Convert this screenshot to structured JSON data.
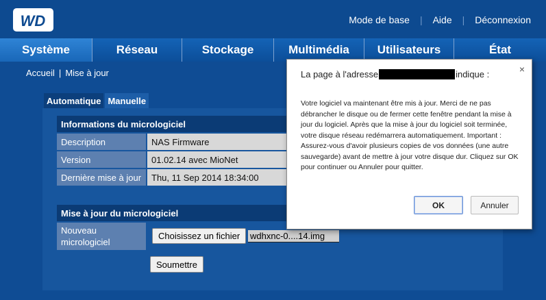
{
  "header": {
    "links": [
      "Mode de base",
      "Aide",
      "Déconnexion"
    ]
  },
  "nav": {
    "tabs": [
      "Système",
      "Réseau",
      "Stockage",
      "Multimédia",
      "Utilisateurs",
      "État"
    ],
    "active": "Système"
  },
  "breadcrumb": {
    "home": "Accueil",
    "separator": "|",
    "current": "Mise à jour"
  },
  "subtabs": {
    "auto": "Automatique",
    "manual": "Manuelle"
  },
  "firmware_info": {
    "title": "Informations du micrologiciel",
    "rows": [
      {
        "label": "Description",
        "value": "NAS Firmware"
      },
      {
        "label": "Version",
        "value": "01.02.14 avec MioNet"
      },
      {
        "label": "Dernière mise à jour",
        "value": "Thu, 11 Sep 2014 18:34:00"
      }
    ]
  },
  "firmware_update": {
    "title": "Mise à jour du micrologiciel",
    "new_label": "Nouveau micrologiciel",
    "choose_file": "Choisissez un fichier",
    "file_name": "wdhxnc-0....14.img",
    "submit": "Soumettre"
  },
  "dialog": {
    "title_prefix": "La page à l'adresse",
    "title_suffix": "indique :",
    "close": "×",
    "message": "Votre logiciel va maintenant être mis à jour. Merci de ne pas débrancher le disque ou de fermer cette fenêtre pendant la mise à jour du logiciel. Après que la mise à jour du logiciel soit terminée, votre disque réseau redémarrera automatiquement. Important : Assurez-vous d'avoir plusieurs copies de vos données (une autre sauvegarde) avant de mettre à jour votre disque dur. Cliquez sur OK pour continuer ou Annuler pour quitter.",
    "ok": "OK",
    "cancel": "Annuler"
  },
  "colors": {
    "background": "#0f4c94",
    "header": "#0d4a90",
    "accent_tab": "#2f84d6"
  }
}
